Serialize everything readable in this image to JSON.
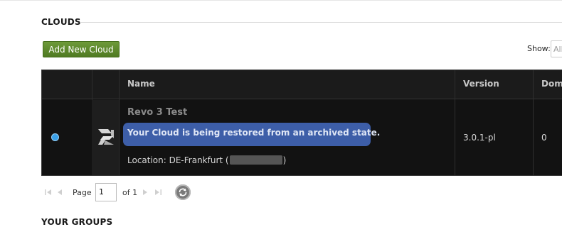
{
  "clouds_section": {
    "title": "CLOUDS",
    "add_button": "Add New Cloud",
    "show_label": "Show:",
    "show_value": "All"
  },
  "grid": {
    "columns": {
      "name": "Name",
      "version": "Version",
      "domains": "Doma"
    },
    "rows": [
      {
        "name": "Revo 3 Test",
        "status_message": "Your Cloud is being restored from an archived state.",
        "location_prefix": "Location: DE-Frankfurt (",
        "location_suffix": ")",
        "version": "3.0.1-pl",
        "domains": "0"
      }
    ]
  },
  "pager": {
    "page_label": "Page",
    "page_value": "1",
    "of_label": "of 1"
  },
  "groups_section": {
    "title": "YOUR GROUPS"
  },
  "colors": {
    "accent_green": "#5a8a2c",
    "badge_blue": "#3d5ea8",
    "grid_bg": "#121212",
    "radio_blue": "#3aa0e8"
  }
}
